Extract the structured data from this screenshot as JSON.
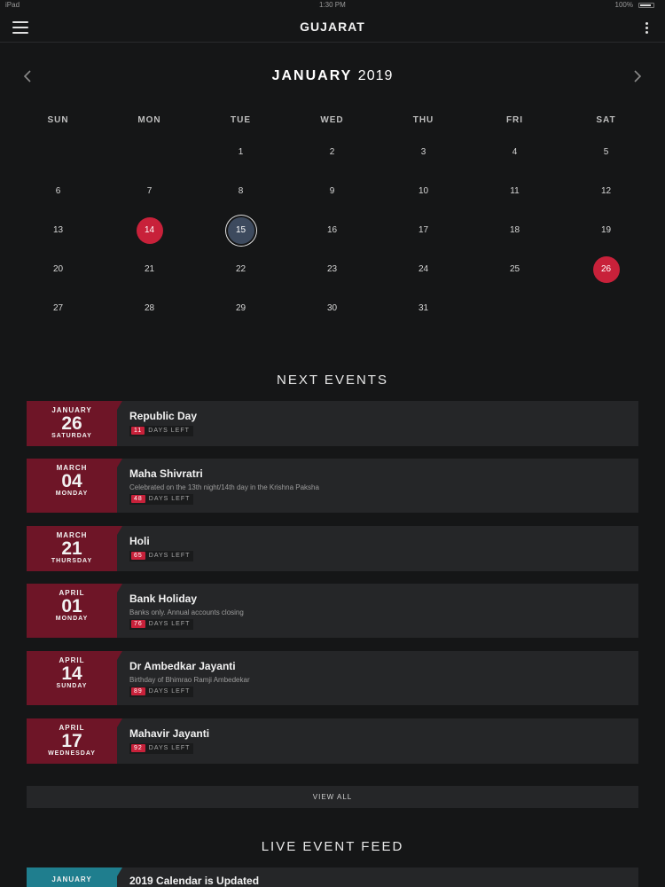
{
  "status_bar": {
    "carrier": "iPad",
    "time": "1:30 PM",
    "battery": "100%"
  },
  "navbar": {
    "title": "GUJARAT"
  },
  "calendar": {
    "month": "JANUARY",
    "year": "2019",
    "weekdays": [
      "SUN",
      "MON",
      "TUE",
      "WED",
      "THU",
      "FRI",
      "SAT"
    ],
    "first_weekday_index": 2,
    "days_in_month": 31,
    "holidays": [
      14,
      26
    ],
    "today": 15
  },
  "next_events": {
    "title": "NEXT EVENTS",
    "days_left_label": "DAYS LEFT",
    "items": [
      {
        "month": "JANUARY",
        "day": "26",
        "weekday": "SATURDAY",
        "name": "Republic Day",
        "description": "",
        "days_left": "11"
      },
      {
        "month": "MARCH",
        "day": "04",
        "weekday": "MONDAY",
        "name": "Maha Shivratri",
        "description": "Celebrated on the 13th night/14th day in the Krishna Paksha",
        "days_left": "48"
      },
      {
        "month": "MARCH",
        "day": "21",
        "weekday": "THURSDAY",
        "name": "Holi",
        "description": "",
        "days_left": "65"
      },
      {
        "month": "APRIL",
        "day": "01",
        "weekday": "MONDAY",
        "name": "Bank Holiday",
        "description": "Banks only. Annual accounts closing",
        "days_left": "76"
      },
      {
        "month": "APRIL",
        "day": "14",
        "weekday": "SUNDAY",
        "name": "Dr Ambedkar Jayanti",
        "description": "Birthday of Bhimrao Ramji Ambedekar",
        "days_left": "89"
      },
      {
        "month": "APRIL",
        "day": "17",
        "weekday": "WEDNESDAY",
        "name": "Mahavir Jayanti",
        "description": "",
        "days_left": "92"
      }
    ],
    "view_all_label": "VIEW ALL"
  },
  "live_feed": {
    "title": "LIVE EVENT FEED",
    "items": [
      {
        "month": "JANUARY",
        "title": "2019 Calendar is Updated"
      }
    ]
  },
  "colors": {
    "background": "#151617",
    "card": "#252628",
    "holiday_red": "#c8213a",
    "date_box": "#6e1527",
    "feed_teal": "#1f7e8e",
    "today_blue": "#3d4a5e"
  },
  "icons": {
    "menu": "hamburger-icon",
    "more": "kebab-icon",
    "prev": "chevron-left-icon",
    "next": "chevron-right-icon"
  }
}
